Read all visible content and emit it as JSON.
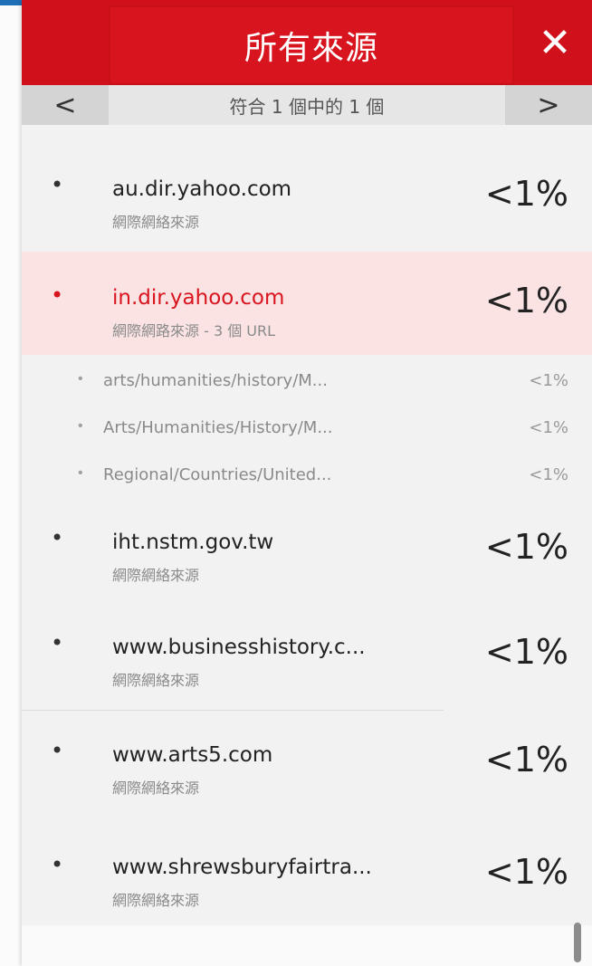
{
  "header": {
    "title": "所有來源",
    "close_icon": "close-icon"
  },
  "nav": {
    "prev_glyph": "<",
    "next_glyph": ">",
    "match_text": "符合 1 個中的 1 個"
  },
  "sources": [
    {
      "domain": "au.dir.yahoo.com",
      "subtitle": "網際網絡來源",
      "percent": "<1%"
    },
    {
      "domain": "in.dir.yahoo.com",
      "subtitle": "網際網路來源 - 3 個 URL",
      "percent": "<1%"
    },
    {
      "domain": "iht.nstm.gov.tw",
      "subtitle": "網際網絡來源",
      "percent": "<1%"
    },
    {
      "domain": "www.businesshistory.c...",
      "subtitle": "網際網絡來源",
      "percent": "<1%"
    },
    {
      "domain": "www.arts5.com",
      "subtitle": "網際網絡來源",
      "percent": "<1%"
    },
    {
      "domain": "www.shrewsburyfairtra...",
      "subtitle": "網際網絡來源",
      "percent": "<1%"
    }
  ],
  "sub_urls": [
    {
      "path": "arts/humanities/history/M...",
      "percent": "<1%"
    },
    {
      "path": "Arts/Humanities/History/M...",
      "percent": "<1%"
    },
    {
      "path": "Regional/Countries/United...",
      "percent": "<1%"
    }
  ],
  "colors": {
    "brand_red": "#d0101a",
    "highlight_bg": "#fbe3e4",
    "panel_bg": "#f2f2f2"
  }
}
